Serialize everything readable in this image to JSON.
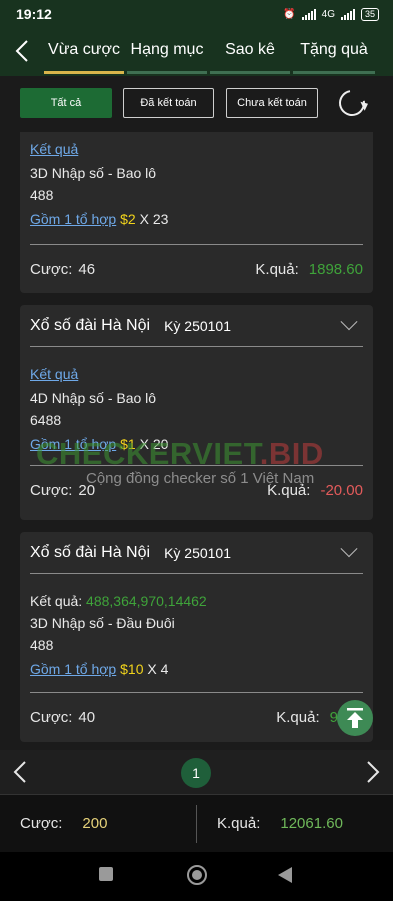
{
  "status": {
    "time": "19:12",
    "network": "4G",
    "battery": "35"
  },
  "tabs": [
    {
      "label": "Vừa cược",
      "active": true
    },
    {
      "label": "Hạng mục",
      "active": false
    },
    {
      "label": "Sao kê",
      "active": false
    },
    {
      "label": "Tặng quà",
      "active": false
    }
  ],
  "filters": [
    {
      "label": "Tất cả",
      "active": true
    },
    {
      "label": "Đã kết toán",
      "active": false
    },
    {
      "label": "Chưa kết toán",
      "active": false
    }
  ],
  "cards": [
    {
      "result_label": "Kết quả",
      "result_value": "",
      "bet_type": "3D Nhập số - Bao lô",
      "numbers": "488",
      "combo_label": "Gồm 1 tổ hợp",
      "unit": "$2",
      "multiplier": "X 23",
      "bet_label": "Cược:",
      "bet": "46",
      "outcome_label": "K.quả:",
      "outcome": "1898.60"
    },
    {
      "lottery": "Xổ số đài Hà Nội",
      "period": "Kỳ 250101",
      "result_label": "Kết quả",
      "result_value": "",
      "bet_type": "4D Nhập số - Bao lô",
      "numbers": "6488",
      "combo_label": "Gồm 1 tổ hợp",
      "unit": "$1",
      "multiplier": "X 20",
      "bet_label": "Cược:",
      "bet": "20",
      "outcome_label": "K.quả:",
      "outcome": "-20.00"
    },
    {
      "lottery": "Xổ số đài Hà Nội",
      "period": "Kỳ 250101",
      "result_label": "Kết quả:",
      "result_value": "488,364,970,14462",
      "bet_type": "3D Nhập số - Đầu Đuôi",
      "numbers": "488",
      "combo_label": "Gồm 1 tổ hợp",
      "unit": "$10",
      "multiplier": "X 4",
      "bet_label": "Cược:",
      "bet": "40",
      "outcome_label": "K.quả:",
      "outcome": "9683"
    }
  ],
  "watermark": {
    "title_main": "CHECKERVIET",
    "title_suffix": ".BID",
    "subtitle": "Cộng đồng checker số 1 Việt Nam"
  },
  "pager": {
    "current": "1"
  },
  "summary": {
    "bet_label": "Cược:",
    "bet": "200",
    "outcome_label": "K.quả:",
    "outcome": "12061.60"
  },
  "colors": {
    "header": "#18331f",
    "accent_gold": "#d9b54b",
    "win_green": "#3fa33a",
    "loss_red": "#e35b5b",
    "stake_yellow": "#f1d31b",
    "link_blue": "#6fa9e8"
  }
}
